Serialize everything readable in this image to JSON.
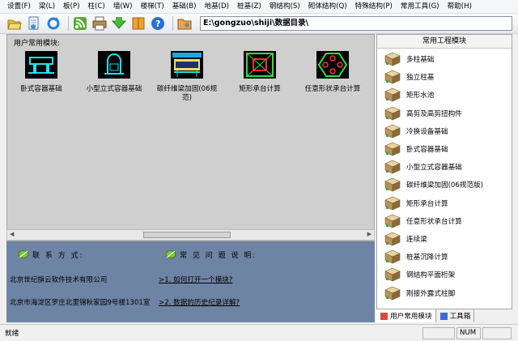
{
  "menu": [
    "设置(F)",
    "梁(L)",
    "板(P)",
    "柱(C)",
    "墙(W)",
    "楼梯(T)",
    "基础(B)",
    "地基(D)",
    "桩基(Z)",
    "钢结构(S)",
    "砌体结构(Q)",
    "特殊结构(P)",
    "常用工具(G)",
    "帮助(H)"
  ],
  "toolbar": {
    "icons": [
      "open-folder-icon",
      "document-icon",
      "refresh-icon",
      "rss-icon",
      "print-icon",
      "down-arrow-icon",
      "book-icon",
      "help-icon",
      "folder-tools-icon"
    ],
    "path": "E:\\gongzuo\\shiji\\数据目录\\"
  },
  "left": {
    "title": "用户常用模块:",
    "modules": [
      {
        "label": "卧式容器基础"
      },
      {
        "label": "小型立式容器基础"
      },
      {
        "label": "碳纤维梁加固(06规",
        "label2": "范)"
      },
      {
        "label": "矩形承台计算"
      },
      {
        "label": "任意形状承台计算"
      }
    ]
  },
  "info": {
    "contact_title": "联 系 方 式:",
    "faq_title": "常 见 问 题 说 明:",
    "company": "北京世纪旗云软件技术有限公司",
    "address": "北京市海淀区罗庄北里锦秋家园9号楼1301室",
    "faq1": ">1. 如何打开一个模块?",
    "faq2": ">2. 数据的历史纪录详解?"
  },
  "right": {
    "header": "常用工程模块",
    "items": [
      "多柱基础",
      "独立柱基",
      "矩形水池",
      "高剪及高剪扭构件",
      "冷换设备基础",
      "卧式容器基础",
      "小型立式容器基础",
      "碳纤维梁加固(06规范版)",
      "矩形承台计算",
      "任意形状承台计算",
      "连续梁",
      "桩基沉降计算",
      "钢结构平面桁架",
      "刚接外露式柱脚"
    ]
  },
  "tabs": {
    "user": "用户常用模块",
    "tools": "工具箱"
  },
  "status": {
    "text": "就绪",
    "num": "NUM"
  },
  "colors": {
    "info_bg": "#6e84a4",
    "module_bg": "#cfcfcf",
    "cube": "#c8a46a"
  }
}
